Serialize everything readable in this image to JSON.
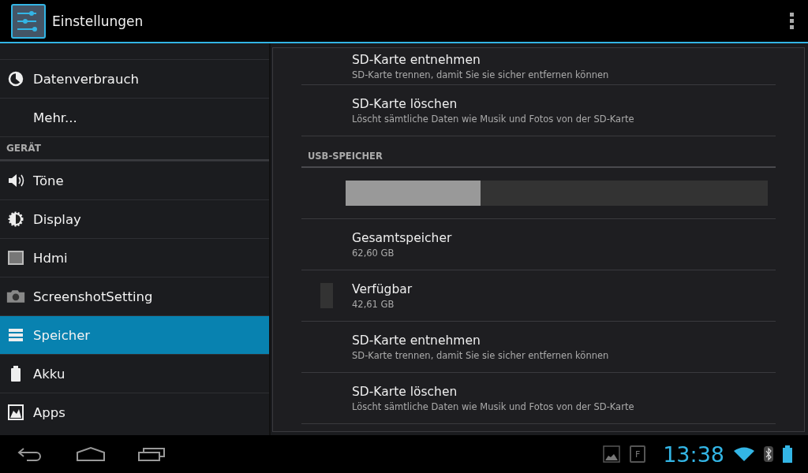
{
  "action_bar": {
    "title": "Einstellungen"
  },
  "sidebar": {
    "items": [
      {
        "kind": "item",
        "label": "Datenverbrauch",
        "selected": false
      },
      {
        "kind": "item",
        "label": "Mehr...",
        "selected": false
      },
      {
        "kind": "header",
        "label": "GERÄT"
      },
      {
        "kind": "item",
        "label": "Töne",
        "selected": false
      },
      {
        "kind": "item",
        "label": "Display",
        "selected": false
      },
      {
        "kind": "item",
        "label": "Hdmi",
        "selected": false
      },
      {
        "kind": "item",
        "label": "ScreenshotSetting",
        "selected": false
      },
      {
        "kind": "item",
        "label": "Speicher",
        "selected": true
      },
      {
        "kind": "item",
        "label": "Akku",
        "selected": false
      },
      {
        "kind": "item",
        "label": "Apps",
        "selected": false
      }
    ]
  },
  "storage": {
    "items": [
      {
        "kind": "entry",
        "title": "SD-Karte entnehmen",
        "summary": "SD-Karte trennen, damit Sie sie sicher entfernen können"
      },
      {
        "kind": "entry",
        "title": "SD-Karte löschen",
        "summary": "Löscht sämtliche Daten wie Musik und Fotos von der SD-Karte"
      },
      {
        "kind": "header",
        "title": "USB-SPEICHER"
      },
      {
        "kind": "bar",
        "level": 0.32
      },
      {
        "kind": "entry",
        "title": "Gesamtspeicher",
        "summary": "62,60 GB"
      },
      {
        "kind": "legend",
        "title": "Verfügbar",
        "summary": "42,61 GB",
        "color": "#333333"
      },
      {
        "kind": "entry",
        "title": "SD-Karte entnehmen",
        "summary": "SD-Karte trennen, damit Sie sie sicher entfernen können"
      },
      {
        "kind": "entry",
        "title": "SD-Karte löschen",
        "summary": "Löscht sämtliche Daten wie Musik und Fotos von der SD-Karte"
      }
    ]
  },
  "system_bar": {
    "notification_letter": "F",
    "time": "13:38"
  }
}
